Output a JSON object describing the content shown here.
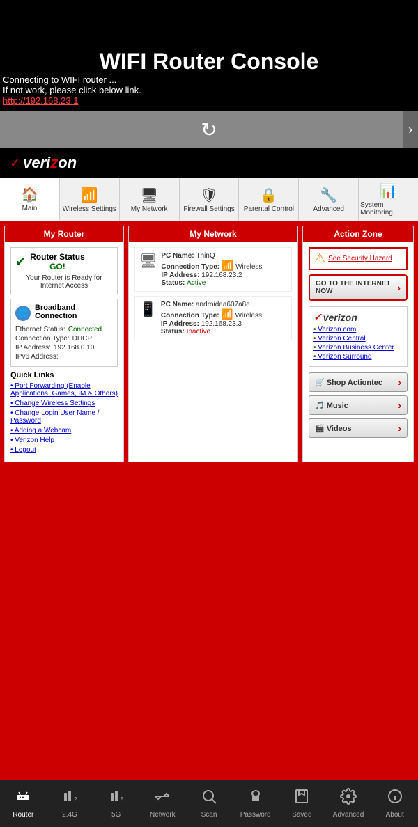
{
  "app": {
    "title": "WIFI Router Console",
    "subtitle": "Connecting to WIFI router ...",
    "subtitle2": "If not work, please click below link.",
    "router_link": "http://192.168.23.1"
  },
  "nav_tabs": [
    {
      "id": "main",
      "label": "Main",
      "icon": "🏠",
      "active": true
    },
    {
      "id": "wireless",
      "label": "Wireless Settings",
      "icon": "📶"
    },
    {
      "id": "my-network",
      "label": "My Network",
      "icon": "🖥"
    },
    {
      "id": "firewall",
      "label": "Firewall Settings",
      "icon": "🛡"
    },
    {
      "id": "parental",
      "label": "Parental Control",
      "icon": "👨‍👧"
    },
    {
      "id": "advanced",
      "label": "Advanced",
      "icon": "🔧"
    },
    {
      "id": "system",
      "label": "System Monitoring",
      "icon": "📊"
    }
  ],
  "my_router": {
    "panel_title": "My Router",
    "router_status_title": "Router Status",
    "router_status_value": "GO!",
    "router_desc": "Your Router is Ready for Internet Access",
    "broadband_title": "Broadband Connection",
    "ethernet_label": "Ethernet Status:",
    "ethernet_value": "Connected",
    "connection_label": "Connection Type:",
    "connection_value": "DHCP",
    "ip_label": "IP Address:",
    "ip_value": "192.168.0.10",
    "ipv6_label": "IPv6 Address:",
    "ipv6_value": "",
    "quick_links_title": "Quick Links",
    "links": [
      "Port Forwarding (Enable Applications, Games, IM & Others)",
      "Change Wireless Settings",
      "Change Login User Name / Password",
      "Adding a Webcam",
      "Verizon Help",
      "Logout"
    ]
  },
  "my_network": {
    "panel_title": "My Network",
    "devices": [
      {
        "name_label": "PC Name:",
        "name_value": "ThinQ",
        "conn_label": "Connection Type:",
        "conn_value": "Wireless",
        "ip_label": "IP Address:",
        "ip_value": "192.168.23.2",
        "status_label": "Status:",
        "status_value": "Active",
        "status_active": true
      },
      {
        "name_label": "PC Name:",
        "name_value": "androidea607a8e...",
        "conn_label": "Connection Type:",
        "conn_value": "Wireless",
        "ip_label": "IP Address:",
        "ip_value": "192.168.23.3",
        "status_label": "Status:",
        "status_value": "Inactive",
        "status_active": false
      }
    ]
  },
  "action_zone": {
    "panel_title": "Action Zone",
    "security_text": "See Security Hazard",
    "internet_btn_label": "GO TO THE INTERNET NOW",
    "verizon_links_title": "verizon",
    "vz_links": [
      "Verizon.com",
      "Verizon Central",
      "Verizon Business Center",
      "Verizon Surround"
    ],
    "action_buttons": [
      {
        "icon": "🛒",
        "label": "Shop Actiontec"
      },
      {
        "icon": "🎵",
        "label": "Music"
      },
      {
        "icon": "🎬",
        "label": "Videos"
      }
    ]
  },
  "bottom_nav": [
    {
      "id": "router",
      "label": "Router",
      "icon": "router",
      "active": true
    },
    {
      "id": "2g",
      "label": "2.4G",
      "icon": "2g"
    },
    {
      "id": "5g",
      "label": "5G",
      "icon": "5g"
    },
    {
      "id": "network",
      "label": "Network",
      "icon": "network"
    },
    {
      "id": "scan",
      "label": "Scan",
      "icon": "scan"
    },
    {
      "id": "password",
      "label": "Password",
      "icon": "password"
    },
    {
      "id": "saved",
      "label": "Saved",
      "icon": "saved"
    },
    {
      "id": "advanced",
      "label": "Advanced",
      "icon": "advanced"
    },
    {
      "id": "about",
      "label": "About",
      "icon": "about"
    }
  ]
}
